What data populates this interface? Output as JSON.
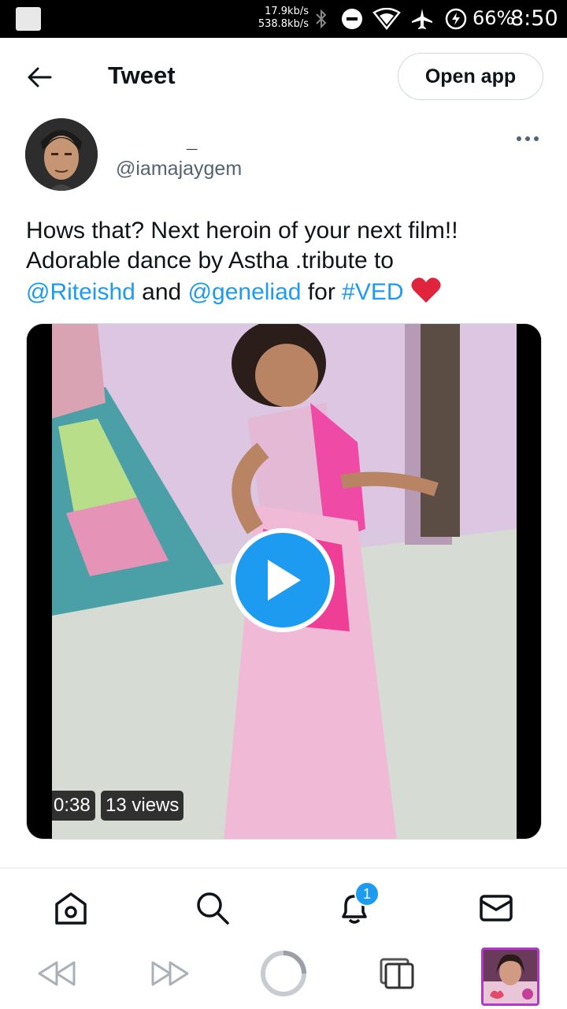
{
  "status_bar": {
    "upload_speed": "17.9kb/s",
    "download_speed": "538.8kb/s",
    "battery": "66%",
    "time": "8:50",
    "icons": [
      "bluetooth-icon",
      "dnd-icon",
      "wifi-icon",
      "airplane-icon",
      "battery-saver-icon"
    ]
  },
  "header": {
    "title": "Tweet",
    "open_app_label": "Open app"
  },
  "author": {
    "display_name": "_",
    "handle": "@iamajaygem"
  },
  "tweet": {
    "line1": "Hows that? Next heroin of your next film!!",
    "line2": "Adorable dance by Astha .tribute to",
    "mention1": "@Riteishd",
    "and": " and ",
    "mention2": "@geneliad",
    "for": " for ",
    "hashtag": "#VED"
  },
  "video": {
    "duration": "0:38",
    "views": "13 views"
  },
  "nav": {
    "notification_count": "1",
    "tabs": [
      "home-icon",
      "search-icon",
      "notifications-icon",
      "messages-icon"
    ]
  },
  "browser": {
    "buttons": [
      "back-icon",
      "forward-icon",
      "loading-icon",
      "tabs-icon"
    ]
  },
  "colors": {
    "accent": "#1d9bf0",
    "text": "#0f1419",
    "secondary": "#536471",
    "heart": "#f91880"
  }
}
